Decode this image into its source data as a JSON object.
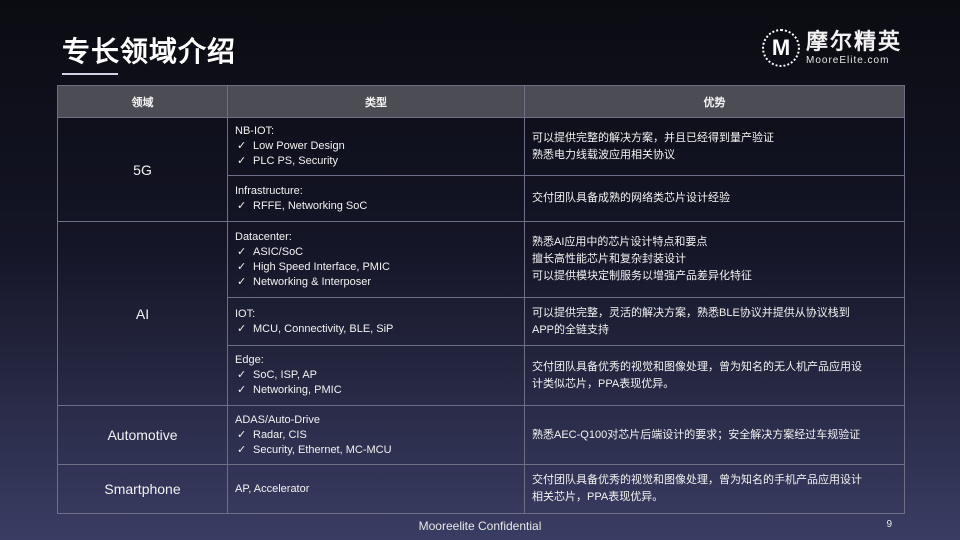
{
  "title": "专长领域介绍",
  "logo": {
    "mark": "M",
    "cn": "摩尔精英",
    "en": "MooreElite.com"
  },
  "table": {
    "headers": [
      "领域",
      "类型",
      "优势"
    ],
    "check_glyph": "✓",
    "rows": [
      {
        "domain": "5G",
        "type_title": "NB-IOT:",
        "type_items": [
          "Low Power Design",
          "PLC PS, Security"
        ],
        "adv": [
          "可以提供完整的解决方案，并且已经得到量产验证",
          "熟悉电力线载波应用相关协议"
        ]
      },
      {
        "type_title": "Infrastructure:",
        "type_items": [
          "RFFE, Networking SoC"
        ],
        "adv": [
          "交付团队具备成熟的网络类芯片设计经验"
        ]
      },
      {
        "domain": "AI",
        "type_title": "Datacenter:",
        "type_items": [
          "ASIC/SoC",
          "High Speed Interface, PMIC",
          "Networking & Interposer"
        ],
        "adv": [
          "熟悉AI应用中的芯片设计特点和要点",
          "擅长高性能芯片和复杂封装设计",
          "可以提供模块定制服务以增强产品差异化特征"
        ]
      },
      {
        "type_title": "IOT:",
        "type_items": [
          "MCU, Connectivity, BLE, SiP"
        ],
        "adv": [
          "可以提供完整，灵活的解决方案，熟悉BLE协议并提供从协议栈到",
          "APP的全链支持"
        ]
      },
      {
        "type_title": "Edge:",
        "type_items": [
          "SoC, ISP, AP",
          "Networking, PMIC"
        ],
        "adv": [
          "交付团队具备优秀的视觉和图像处理，曾为知名的无人机产品应用设",
          "计类似芯片，PPA表现优异。"
        ]
      },
      {
        "domain": "Automotive",
        "type_title": "ADAS/Auto-Drive",
        "type_items": [
          "Radar, CIS",
          "Security, Ethernet, MC-MCU"
        ],
        "adv": [
          "熟悉AEC-Q100对芯片后端设计的要求；安全解决方案经过车规验证"
        ]
      },
      {
        "domain": "Smartphone",
        "type_title": "AP, Accelerator",
        "type_items": [],
        "adv": [
          "交付团队具备优秀的视觉和图像处理，曾为知名的手机产品应用设计",
          "相关芯片，PPA表现优异。"
        ]
      }
    ]
  },
  "footer": "Mooreelite Confidential",
  "page_number": "9"
}
